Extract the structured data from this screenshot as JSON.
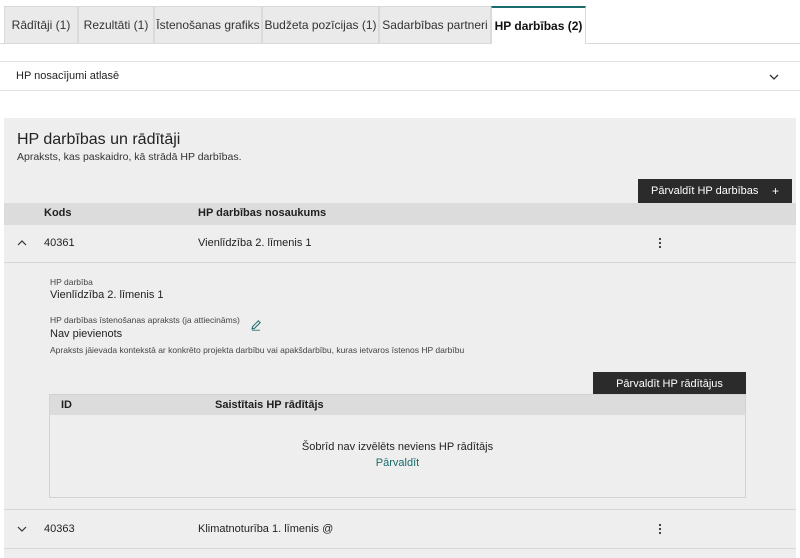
{
  "tabs": [
    {
      "label": "Rādītāji (1)",
      "active": false
    },
    {
      "label": "Rezultāti (1)",
      "active": false
    },
    {
      "label": "Īstenošanas grafiks",
      "active": false
    },
    {
      "label": "Budžeta pozīcijas (1)",
      "active": false
    },
    {
      "label": "Sadarbības partneri",
      "active": false
    },
    {
      "label": "HP darbības (2)",
      "active": true
    }
  ],
  "accordion": {
    "label": "HP nosacījumi atlasē",
    "icon": "chevron-down-icon"
  },
  "section": {
    "title": "HP darbības un rādītāji",
    "description": "Apraksts, kas paskaidro, kā strādā HP darbības.",
    "manage_button": "Pārvaldīt HP darbības",
    "manage_button_icon": "+"
  },
  "table": {
    "columns": [
      "Kods",
      "HP darbības nosaukums"
    ],
    "rows": [
      {
        "code": "40361",
        "name": "Vienlīdzība 2. līmenis 1",
        "expanded": true
      },
      {
        "code": "40363",
        "name": "Klimatnoturība 1. līmenis @",
        "expanded": false
      }
    ]
  },
  "detail": {
    "action_label": "HP darbība",
    "action_value": "Vienlīdzība 2. līmenis 1",
    "impl_label": "HP darbības īstenošanas apraksts (ja attiecināms)",
    "impl_value": "Nav pievienots",
    "impl_hint": "Apraksts jāievada kontekstā ar konkrēto projekta darbību vai apakšdarbību, kuras ietvaros īstenos HP darbību",
    "manage_indicators_button": "Pārvaldīt HP rādītājus",
    "indicators": {
      "columns": [
        "ID",
        "Saistītais HP rādītājs"
      ],
      "empty_message": "Šobrīd nav izvēlēts neviens HP rādītājs",
      "empty_link": "Pārvaldīt"
    }
  },
  "colors": {
    "accent": "#1a6b6b",
    "dark_button": "#2b2b2b",
    "panel": "#eeeeee",
    "header": "#dcdcdc"
  }
}
